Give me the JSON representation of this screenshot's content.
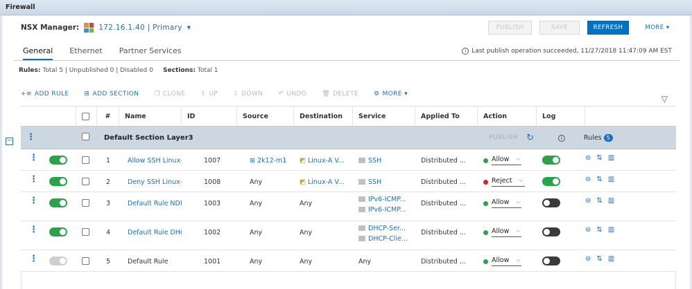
{
  "window": {
    "title": "Firewall"
  },
  "manager": {
    "label": "NSX Manager:",
    "ip": "172.16.1.40 | Primary",
    "chevron": "▾",
    "icon": "nsx-manager-icon"
  },
  "top_actions": {
    "publish": "PUBLISH",
    "save": "SAVE",
    "refresh": "REFRESH",
    "more": "MORE ▾"
  },
  "tabs": [
    "General",
    "Ethernet",
    "Partner Services"
  ],
  "publish_status": "Last publish operation succeeded, 11/27/2018 11:47:09 AM EST",
  "summary": {
    "rules_label": "Rules:",
    "rules_text": "Total 5 | Unpublished 0 | Disabled 0",
    "sections_label": "Sections:",
    "sections_text": "Total 1"
  },
  "toolbar": {
    "add_rule": "ADD RULE",
    "add_section": "ADD SECTION",
    "clone": "CLONE",
    "up": "UP",
    "down": "DOWN",
    "undo": "UNDO",
    "delete": "DELETE",
    "more": "MORE ▾"
  },
  "columns": {
    "num": "#",
    "name": "Name",
    "id": "ID",
    "source": "Source",
    "destination": "Destination",
    "service": "Service",
    "applied_to": "Applied To",
    "action": "Action",
    "log": "Log"
  },
  "section": {
    "name": "Default Section Layer3",
    "publish": "PUBLISH",
    "rules_label": "Rules",
    "rules_count": "5"
  },
  "rules": [
    {
      "num": "1",
      "name": "Allow SSH Linux-A",
      "id": "1007",
      "source": "2k12-m1",
      "destination": "Linux-A V...",
      "services": [
        "SSH"
      ],
      "applied_to": "Distributed ...",
      "action": "Allow",
      "action_color": "#2aa34a",
      "enabled": true,
      "log": true
    },
    {
      "num": "2",
      "name": "Deny SSH Linux-A",
      "id": "1008",
      "source": "Any",
      "destination": "Linux-A V...",
      "services": [
        "SSH"
      ],
      "applied_to": "Distributed ...",
      "action": "Reject",
      "action_color": "#e02020",
      "enabled": true,
      "log": true
    },
    {
      "num": "3",
      "name": "Default Rule NDP",
      "id": "1003",
      "source": "Any",
      "destination": "Any",
      "services": [
        "IPv6-ICMP...",
        "IPv6-ICMP..."
      ],
      "applied_to": "Distributed ...",
      "action": "Allow",
      "action_color": "#2aa34a",
      "enabled": true,
      "log": false
    },
    {
      "num": "4",
      "name": "Default Rule DHCP",
      "id": "1002",
      "source": "Any",
      "destination": "Any",
      "services": [
        "DHCP-Ser...",
        "DHCP-Clie..."
      ],
      "applied_to": "Distributed ...",
      "action": "Allow",
      "action_color": "#2aa34a",
      "enabled": true,
      "log": false
    },
    {
      "num": "5",
      "name": "Default Rule",
      "id": "1001",
      "source": "Any",
      "destination": "Any",
      "services": [
        "Any"
      ],
      "applied_to": "Distributed ...",
      "action": "Allow",
      "action_color": "#2aa34a",
      "enabled": false,
      "log": false
    }
  ]
}
